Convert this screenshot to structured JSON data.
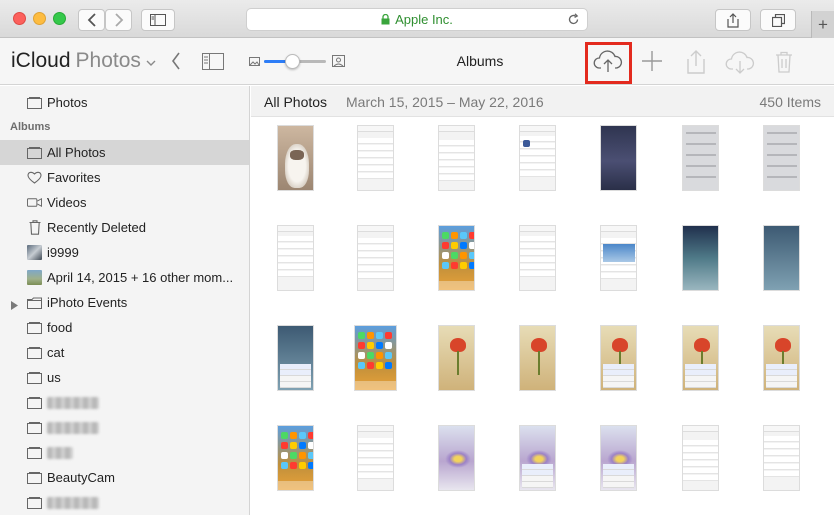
{
  "browser": {
    "address": "Apple Inc."
  },
  "toolbar": {
    "brand": "iCloud",
    "app_name": "Photos",
    "center_title": "Albums"
  },
  "zoom": {
    "level": 0.45
  },
  "sidebar": {
    "top_item": "Photos",
    "section_heading": "Albums",
    "items": [
      {
        "label": "All Photos",
        "icon": "album-icon",
        "selected": true
      },
      {
        "label": "Favorites",
        "icon": "heart-icon"
      },
      {
        "label": "Videos",
        "icon": "video-icon"
      },
      {
        "label": "Recently Deleted",
        "icon": "trash-icon"
      },
      {
        "label": "i9999",
        "icon": "album-thumbnail-icon"
      },
      {
        "label": "April 14, 2015 + 16 other mom...",
        "icon": "album-thumbnail-icon"
      },
      {
        "label": "iPhoto Events",
        "icon": "folder-icon",
        "expandable": true
      },
      {
        "label": "food",
        "icon": "album-icon"
      },
      {
        "label": "cat",
        "icon": "album-icon"
      },
      {
        "label": "us",
        "icon": "album-icon"
      },
      {
        "label": "",
        "icon": "album-icon",
        "redacted": true
      },
      {
        "label": "",
        "icon": "album-icon",
        "redacted": true
      },
      {
        "label": "",
        "icon": "album-icon",
        "redacted": true
      },
      {
        "label": "BeautyCam",
        "icon": "album-icon"
      },
      {
        "label": "",
        "icon": "album-icon",
        "redacted": true
      }
    ]
  },
  "main": {
    "title": "All Photos",
    "date_range": "March 15, 2015 – May 22, 2016",
    "count": "450 Items"
  },
  "colors": {
    "accent": "#2d7df7",
    "highlight_box": "#e32a1e",
    "selected_row": "#d6d6d6"
  }
}
